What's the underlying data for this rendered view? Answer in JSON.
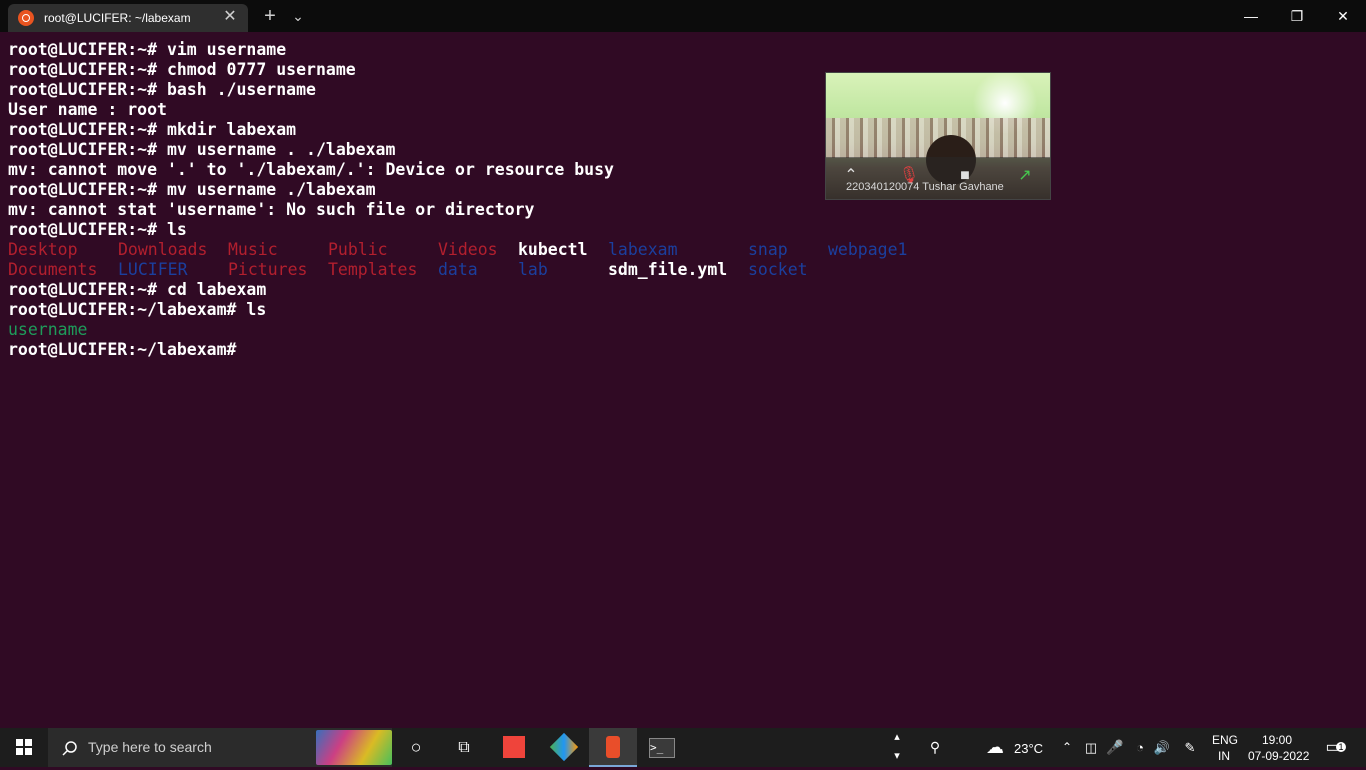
{
  "window": {
    "tab_title": "root@LUCIFER: ~/labexam",
    "tab_close": "✕",
    "new_tab": "+",
    "dropdown": "⌄",
    "minimize": "—",
    "maximize": "❐",
    "close": "✕"
  },
  "terminal": {
    "lines": [
      "root@LUCIFER:~# vim username",
      "root@LUCIFER:~# chmod 0777 username",
      "root@LUCIFER:~# bash ./username",
      "User name : root",
      "root@LUCIFER:~# mkdir labexam",
      "root@LUCIFER:~# mv username . ./labexam",
      "mv: cannot move '.' to './labexam/.': Device or resource busy",
      "root@LUCIFER:~# mv username ./labexam",
      "mv: cannot stat 'username': No such file or directory",
      "root@LUCIFER:~# ls"
    ],
    "ls_row1": [
      "Desktop",
      "Downloads",
      "Music",
      "Public",
      "Videos",
      "kubectl",
      "labexam",
      "snap",
      "webpage1"
    ],
    "ls_row2": [
      "Documents",
      "LUCIFER",
      "Pictures",
      "Templates",
      "data",
      "lab",
      "sdm_file.yml",
      "socket"
    ],
    "after_lines": [
      "root@LUCIFER:~# cd labexam",
      "root@LUCIFER:~/labexam# ls"
    ],
    "ls_labexam": "username",
    "prompt": "root@LUCIFER:~/labexam#"
  },
  "video": {
    "participant": "220340120074 Tushar Gavhane",
    "icons": [
      "chevron-up-icon",
      "mic-muted-icon",
      "camera-icon",
      "share-icon"
    ]
  },
  "taskbar": {
    "search_placeholder": "Type here to search",
    "weather": "23°C",
    "lang_top": "ENG",
    "lang_bottom": "IN",
    "time": "19:00",
    "date": "07-09-2022",
    "notifications": "1"
  }
}
